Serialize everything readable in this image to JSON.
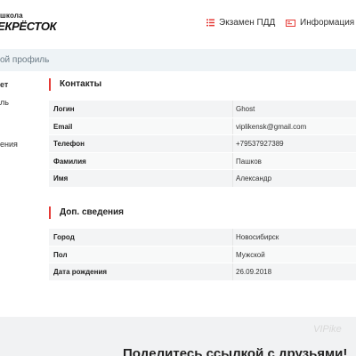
{
  "header": {
    "logo_top": "школа",
    "logo_main": "ЕКРЁСТОК",
    "nav": [
      {
        "label": "Экзамен ПДД",
        "icon": "list-icon",
        "color": "#e53935"
      },
      {
        "label": "Информация",
        "icon": "mail-icon",
        "color": "#e53935"
      }
    ]
  },
  "breadcrumb": "ой профиль",
  "sidebar": [
    "ет",
    "ль",
    "ения"
  ],
  "contacts": {
    "title": "Контакты",
    "rows": [
      {
        "key": "Логин",
        "value": "Ghost"
      },
      {
        "key": "Email",
        "value": "viplikensk@gmail.com"
      },
      {
        "key": "Телефон",
        "value": "+79537927389"
      },
      {
        "key": "Фамилия",
        "value": "Пашков"
      },
      {
        "key": "Имя",
        "value": "Александр"
      }
    ]
  },
  "extra": {
    "title": "Доп. сведения",
    "rows": [
      {
        "key": "Город",
        "value": "Новосибирск"
      },
      {
        "key": "Пол",
        "value": "Мужской"
      },
      {
        "key": "Дата рождения",
        "value": "26.09.2018"
      }
    ]
  },
  "footer": {
    "share_text": "Поделитесь ссылкой с друзьями!",
    "watermark": "VIPike"
  },
  "colors": {
    "accent": "#e53935",
    "band": "#eef3f6"
  }
}
